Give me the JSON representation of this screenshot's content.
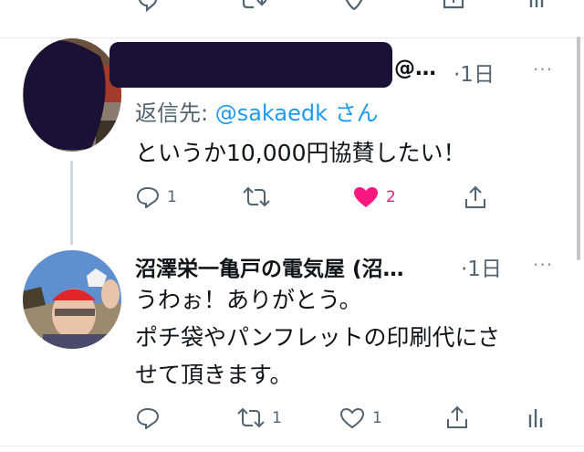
{
  "top_actions": {
    "icons": [
      "reply-icon",
      "retweet-icon",
      "like-icon",
      "share-icon",
      "analytics-icon"
    ]
  },
  "tweet1": {
    "handle": "@…",
    "time": "·1日",
    "more": "···",
    "reply_prefix": "返信先: ",
    "reply_mention": "@sakaedk",
    "reply_suffix": " さん",
    "text": "というか10,000円協賛したい！",
    "replies": "1",
    "likes": "2",
    "liked": true
  },
  "tweet2": {
    "name": "沼澤栄一亀戸の電気屋 (沼…",
    "time": "·1日",
    "more": "···",
    "text_line1": "うわぉ！ありがとう。",
    "text_line2": "ポチ袋やパンフレットの印刷代にさ",
    "text_line3": "せて頂きます。",
    "retweets": "1",
    "likes": "1"
  },
  "colors": {
    "accent": "#1d9bf0",
    "like": "#f91880",
    "muted": "#536471",
    "redaction": "#1b1035"
  }
}
